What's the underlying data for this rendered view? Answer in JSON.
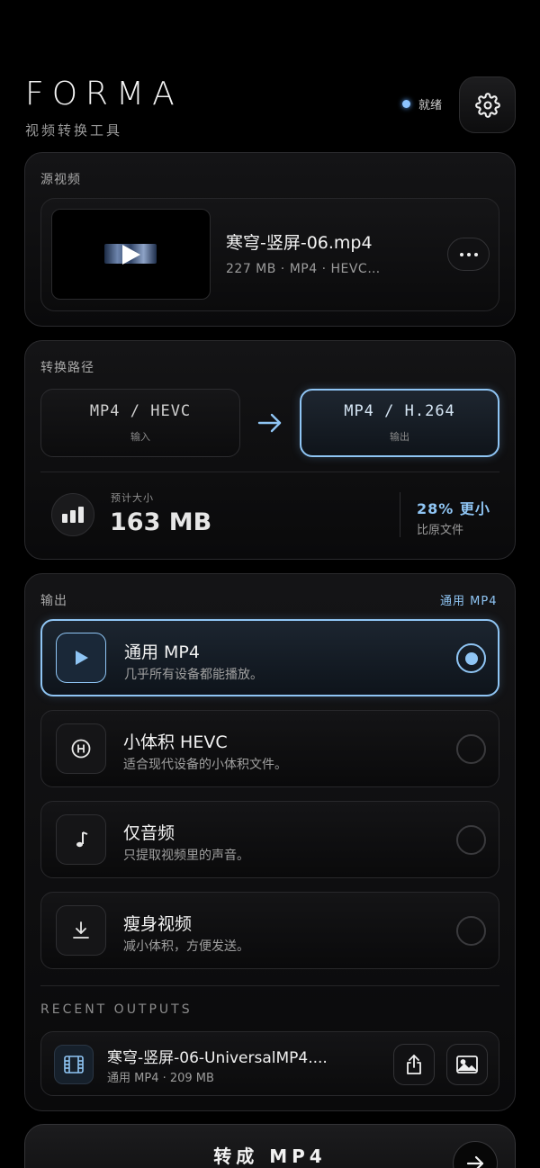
{
  "header": {
    "brand": "FORMA",
    "subtitle": "视频转换工具",
    "status": "就绪",
    "accent_color": "#8fc5f4",
    "settings_icon": "gear-icon"
  },
  "source": {
    "label": "源视频",
    "file_name": "寒穹-竖屏-06.mp4",
    "file_meta": "227 MB · MP4 · HEVC…",
    "more_icon": "more-dots-icon"
  },
  "path": {
    "label": "转换路径",
    "input_format": "MP4 / HEVC",
    "input_label": "输入",
    "output_format": "MP4 / H.264",
    "output_label": "输出",
    "estimate_label": "预计大小",
    "estimate_value": "163 MB",
    "ratio": "28% 更小",
    "ratio_sub": "比原文件"
  },
  "output": {
    "label": "输出",
    "selected_summary": "通用 MP4",
    "options": [
      {
        "title": "通用 MP4",
        "desc": "几乎所有设备都能播放。",
        "icon": "play-icon",
        "selected": true
      },
      {
        "title": "小体积 HEVC",
        "desc": "适合现代设备的小体积文件。",
        "icon": "hevc-icon",
        "selected": false
      },
      {
        "title": "仅音频",
        "desc": "只提取视频里的声音。",
        "icon": "music-note-icon",
        "selected": false
      },
      {
        "title": "瘦身视频",
        "desc": "减小体积，方便发送。",
        "icon": "download-icon",
        "selected": false
      }
    ]
  },
  "recent": {
    "label": "RECENT OUTPUTS",
    "items": [
      {
        "name": "寒穹-竖屏-06-UniversalMP4....",
        "meta": "通用 MP4 · 209 MB"
      }
    ]
  },
  "action": {
    "convert_label": "转成 MP4"
  }
}
